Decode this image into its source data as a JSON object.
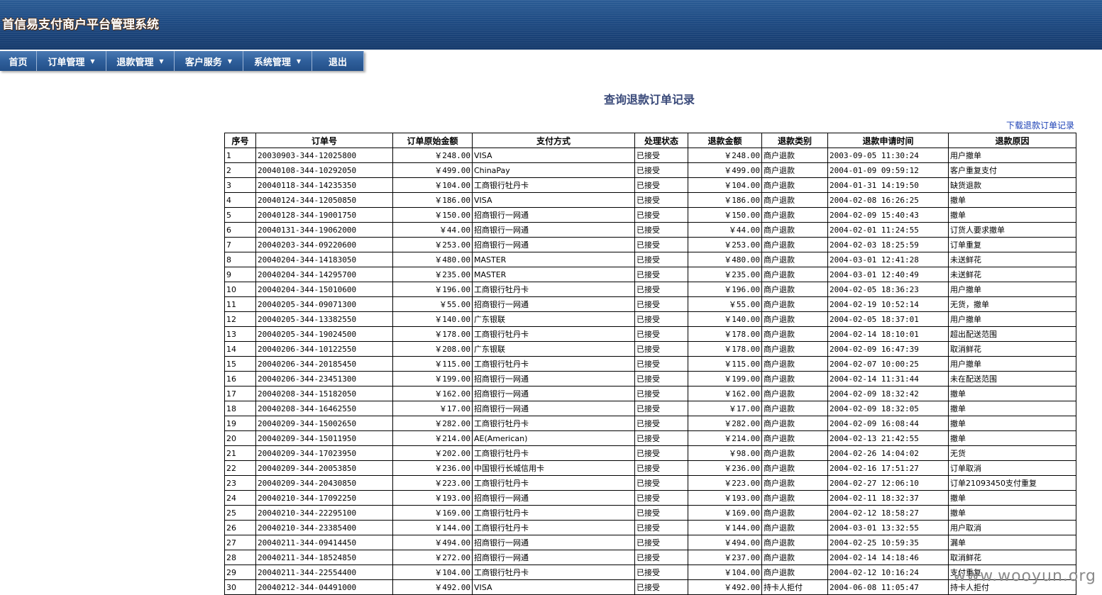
{
  "header": {
    "title": "首信易支付商户平台管理系统"
  },
  "menu": [
    {
      "label": "首页",
      "dropdown": false
    },
    {
      "label": "订单管理",
      "dropdown": true
    },
    {
      "label": "退款管理",
      "dropdown": true
    },
    {
      "label": "客户服务",
      "dropdown": true
    },
    {
      "label": "系统管理",
      "dropdown": true
    },
    {
      "label": "退出",
      "dropdown": false
    }
  ],
  "page": {
    "title": "查询退款订单记录",
    "download_link": "下载退款订单记录"
  },
  "table": {
    "columns": [
      "序号",
      "订单号",
      "订单原始金额",
      "支付方式",
      "处理状态",
      "退款金额",
      "退款类别",
      "退款申请时间",
      "退款原因"
    ],
    "rows": [
      [
        "1",
        "20030903-344-12025800",
        "￥248.00",
        "VISA",
        "已接受",
        "￥248.00",
        "商户退款",
        "2003-09-05 11:30:24",
        "用户撤单"
      ],
      [
        "2",
        "20040108-344-10292050",
        "￥499.00",
        "ChinaPay",
        "已接受",
        "￥499.00",
        "商户退款",
        "2004-01-09 09:59:12",
        "客户重复支付"
      ],
      [
        "3",
        "20040118-344-14235350",
        "￥104.00",
        "工商银行牡丹卡",
        "已接受",
        "￥104.00",
        "商户退款",
        "2004-01-31 14:19:50",
        "缺货退款"
      ],
      [
        "4",
        "20040124-344-12050850",
        "￥186.00",
        "VISA",
        "已接受",
        "￥186.00",
        "商户退款",
        "2004-02-08 16:26:25",
        "撤单"
      ],
      [
        "5",
        "20040128-344-19001750",
        "￥150.00",
        "招商银行一网通",
        "已接受",
        "￥150.00",
        "商户退款",
        "2004-02-09 15:40:43",
        "撤单"
      ],
      [
        "6",
        "20040131-344-19062000",
        "￥44.00",
        "招商银行一网通",
        "已接受",
        "￥44.00",
        "商户退款",
        "2004-02-01 11:24:55",
        "订货人要求撤单"
      ],
      [
        "7",
        "20040203-344-09220600",
        "￥253.00",
        "招商银行一网通",
        "已接受",
        "￥253.00",
        "商户退款",
        "2004-02-03 18:25:59",
        "订单重复"
      ],
      [
        "8",
        "20040204-344-14183050",
        "￥480.00",
        "MASTER",
        "已接受",
        "￥480.00",
        "商户退款",
        "2004-03-01 12:41:28",
        "未送鲜花"
      ],
      [
        "9",
        "20040204-344-14295700",
        "￥235.00",
        "MASTER",
        "已接受",
        "￥235.00",
        "商户退款",
        "2004-03-01 12:40:49",
        "未送鲜花"
      ],
      [
        "10",
        "20040204-344-15010600",
        "￥196.00",
        "工商银行牡丹卡",
        "已接受",
        "￥196.00",
        "商户退款",
        "2004-02-05 18:36:23",
        "用户撤单"
      ],
      [
        "11",
        "20040205-344-09071300",
        "￥55.00",
        "招商银行一网通",
        "已接受",
        "￥55.00",
        "商户退款",
        "2004-02-19 10:52:14",
        "无货，撤单"
      ],
      [
        "12",
        "20040205-344-13382550",
        "￥140.00",
        "广东银联",
        "已接受",
        "￥140.00",
        "商户退款",
        "2004-02-05 18:37:01",
        "用户撤单"
      ],
      [
        "13",
        "20040205-344-19024500",
        "￥178.00",
        "工商银行牡丹卡",
        "已接受",
        "￥178.00",
        "商户退款",
        "2004-02-14 18:10:01",
        "超出配送范围"
      ],
      [
        "14",
        "20040206-344-10122550",
        "￥208.00",
        "广东银联",
        "已接受",
        "￥178.00",
        "商户退款",
        "2004-02-09 16:47:39",
        "取消鲜花"
      ],
      [
        "15",
        "20040206-344-20185450",
        "￥115.00",
        "工商银行牡丹卡",
        "已接受",
        "￥115.00",
        "商户退款",
        "2004-02-07 10:00:25",
        "用户撤单"
      ],
      [
        "16",
        "20040206-344-23451300",
        "￥199.00",
        "招商银行一网通",
        "已接受",
        "￥199.00",
        "商户退款",
        "2004-02-14 11:31:44",
        "未在配送范围"
      ],
      [
        "17",
        "20040208-344-15182050",
        "￥162.00",
        "招商银行一网通",
        "已接受",
        "￥162.00",
        "商户退款",
        "2004-02-09 18:32:42",
        "撤单"
      ],
      [
        "18",
        "20040208-344-16462550",
        "￥17.00",
        "招商银行一网通",
        "已接受",
        "￥17.00",
        "商户退款",
        "2004-02-09 18:32:05",
        "撤单"
      ],
      [
        "19",
        "20040209-344-15002650",
        "￥282.00",
        "工商银行牡丹卡",
        "已接受",
        "￥282.00",
        "商户退款",
        "2004-02-09 16:08:44",
        "撤单"
      ],
      [
        "20",
        "20040209-344-15011950",
        "￥214.00",
        "AE(American)",
        "已接受",
        "￥214.00",
        "商户退款",
        "2004-02-13 21:42:55",
        "撤单"
      ],
      [
        "21",
        "20040209-344-17023950",
        "￥202.00",
        "工商银行牡丹卡",
        "已接受",
        "￥98.00",
        "商户退款",
        "2004-02-26 14:04:02",
        "无货"
      ],
      [
        "22",
        "20040209-344-20053850",
        "￥236.00",
        "中国银行长城信用卡",
        "已接受",
        "￥236.00",
        "商户退款",
        "2004-02-16 17:51:27",
        "订单取消"
      ],
      [
        "23",
        "20040209-344-20430850",
        "￥223.00",
        "工商银行牡丹卡",
        "已接受",
        "￥223.00",
        "商户退款",
        "2004-02-27 12:06:10",
        "订单21093450支付重复"
      ],
      [
        "24",
        "20040210-344-17092250",
        "￥193.00",
        "招商银行一网通",
        "已接受",
        "￥193.00",
        "商户退款",
        "2004-02-11 18:32:37",
        "撤单"
      ],
      [
        "25",
        "20040210-344-22295100",
        "￥169.00",
        "工商银行牡丹卡",
        "已接受",
        "￥169.00",
        "商户退款",
        "2004-02-12 18:58:27",
        "撤单"
      ],
      [
        "26",
        "20040210-344-23385400",
        "￥144.00",
        "工商银行牡丹卡",
        "已接受",
        "￥144.00",
        "商户退款",
        "2004-03-01 13:32:55",
        "用户取消"
      ],
      [
        "27",
        "20040211-344-09414450",
        "￥494.00",
        "招商银行一网通",
        "已接受",
        "￥494.00",
        "商户退款",
        "2004-02-25 10:59:35",
        "漏单"
      ],
      [
        "28",
        "20040211-344-18524850",
        "￥272.00",
        "招商银行一网通",
        "已接受",
        "￥237.00",
        "商户退款",
        "2004-02-14 14:18:46",
        "取消鲜花"
      ],
      [
        "29",
        "20040211-344-22554400",
        "￥104.00",
        "工商银行牡丹卡",
        "已接受",
        "￥104.00",
        "商户退款",
        "2004-02-12 10:16:24",
        "支付重复"
      ],
      [
        "30",
        "20040212-344-04491000",
        "￥492.00",
        "VISA",
        "已接受",
        "￥492.00",
        "持卡人拒付",
        "2004-06-08 11:05:47",
        "持卡人拒付"
      ]
    ]
  },
  "watermark": "www.wooyun.org"
}
